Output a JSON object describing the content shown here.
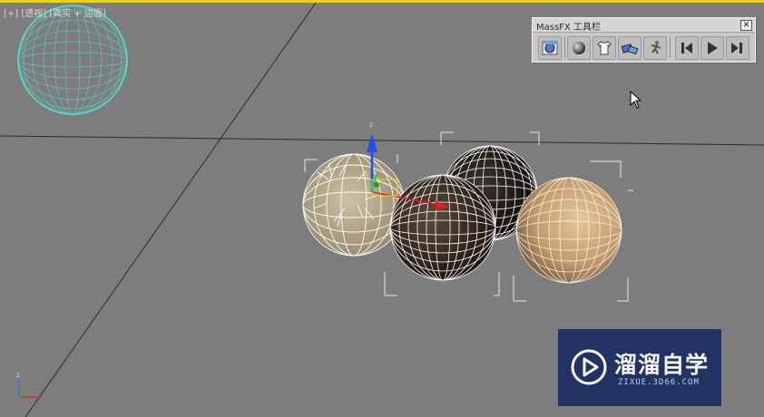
{
  "viewport": {
    "label": "[+] [透视] [真实 + 边面]",
    "gizmo_axis_z": "z",
    "gizmo_axis_y": "y",
    "corner_axis_z": "z"
  },
  "toolbar": {
    "title": "MassFX 工具栏",
    "close": "✕",
    "buttons": [
      {
        "name": "world-parameters",
        "icon": "world-params-icon"
      },
      {
        "name": "rigid-body",
        "icon": "sphere-icon"
      },
      {
        "name": "mcloth",
        "icon": "shirt-icon"
      },
      {
        "name": "constraint",
        "icon": "constraint-icon"
      },
      {
        "name": "ragdoll",
        "icon": "ragdoll-icon"
      },
      {
        "name": "reset-simulation",
        "icon": "reset-sim-icon"
      },
      {
        "name": "start-simulation",
        "icon": "play-sim-icon"
      },
      {
        "name": "step-simulation",
        "icon": "step-sim-icon"
      }
    ]
  },
  "watermark": {
    "title": "溜溜自学",
    "subtitle": "ZIXUE.3D66.COM"
  },
  "colors": {
    "viewport_bg": "#7d7d7d",
    "active_border": "#e8d21a",
    "selected_wire": "#4fe3d0",
    "watermark_bg": "#1e2f63"
  }
}
